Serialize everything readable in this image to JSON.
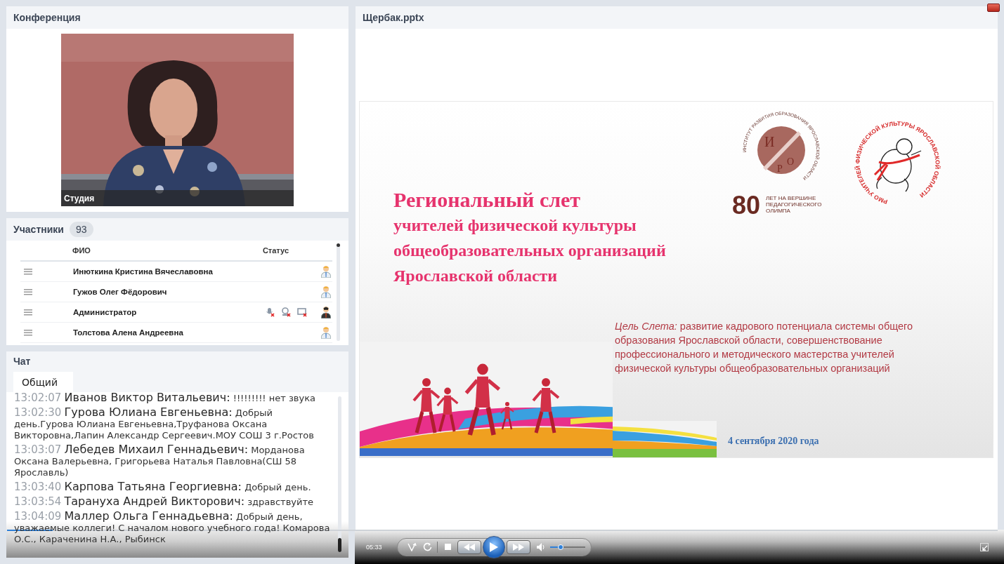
{
  "conference": {
    "title": "Конференция",
    "video_label": "Студия"
  },
  "participants": {
    "title": "Участники",
    "count": "93",
    "columns": [
      "ФИО",
      "Статус"
    ],
    "rows": [
      {
        "name": "Инюткина  Кристина Вячеславовна",
        "kind": "guest",
        "mic_off": false,
        "camera_off": false,
        "screen_off": false
      },
      {
        "name": "Гужов Олег  Фёдорович",
        "kind": "guest",
        "mic_off": false,
        "camera_off": false,
        "screen_off": false
      },
      {
        "name": "Администратор",
        "kind": "admin",
        "mic_off": true,
        "camera_off": true,
        "screen_off": true
      },
      {
        "name": "Толстова Алена  Андреевна",
        "kind": "guest",
        "mic_off": false,
        "camera_off": false,
        "screen_off": false
      }
    ]
  },
  "chat": {
    "title": "Чат",
    "tabs": [
      {
        "label": "Общий",
        "selected": true
      }
    ],
    "messages": [
      {
        "time": "13:02:07",
        "author": "Иванов Виктор  Витальевич:",
        "text": "!!!!!!!!! нет звука"
      },
      {
        "time": "13:02:30",
        "author": "Гурова Юлиана  Евгеньевна:",
        "text": "Добрый день.Гурова Юлиана Евгеньевна,Труфанова Оксана Викторовна,Лапин Александр Сергеевич.МОУ СОШ 3 г.Ростов"
      },
      {
        "time": "13:03:07",
        "author": "Лебедев Михаил  Геннадьевич:",
        "text": "Морданова Оксана Валерьевна, Григорьева Наталья Павловна(СШ  58 Ярославль)"
      },
      {
        "time": "13:03:40",
        "author": "Карпова Татьяна Георгиевна:",
        "text": "Добрый день."
      },
      {
        "time": "13:03:54",
        "author": "Тарануха Андрей   Викторович:",
        "text": "здравствуйте"
      },
      {
        "time": "13:04:09",
        "author": "Маллер  Ольга  Геннадьевна:",
        "text": "Добрый день, уважаемые коллеги! С началом нового учебного года! Комарова О.С., Караченина Н.А., Рыбинск"
      }
    ]
  },
  "presentation": {
    "title": "Щербак.pptx",
    "slide": {
      "title_lines": [
        "Региональный слет",
        "учителей физической культуры",
        "общеобразовательных организаций",
        "Ярославской области"
      ],
      "goal": "*Цель Слета:* развитие кадрового потенциала системы общего образования Ярославской области, совершенствование профессионального и методического мастерства учителей физической культуры общеобразовательных организаций",
      "date": "4 сентября 2020 года",
      "logo_iro": {
        "ring": "ИНСТИТУТ РАЗВИТИЯ ОБРАЗОВАНИЯ ЯРОСЛАВСКОЙ ОБЛАСТИ",
        "letters": [
          "И",
          "Р",
          "О"
        ],
        "number": "80",
        "caption_lines": [
          "ЛЕТ НА ВЕРШИНЕ",
          "ПЕДАГОГИЧЕСКОГО",
          "ОЛИМПА"
        ]
      },
      "logo_rmo": {
        "ring": "РМО УЧИТЕЛЕЙ ФИЗИЧЕСКОЙ КУЛЬТУРЫ ЯРОСЛАВСКОЙ ОБЛАСТИ"
      }
    }
  },
  "player": {
    "time": "05:33",
    "playing": false,
    "seek": {
      "level": 0.046
    },
    "volume": {
      "level": 0.3
    }
  }
}
